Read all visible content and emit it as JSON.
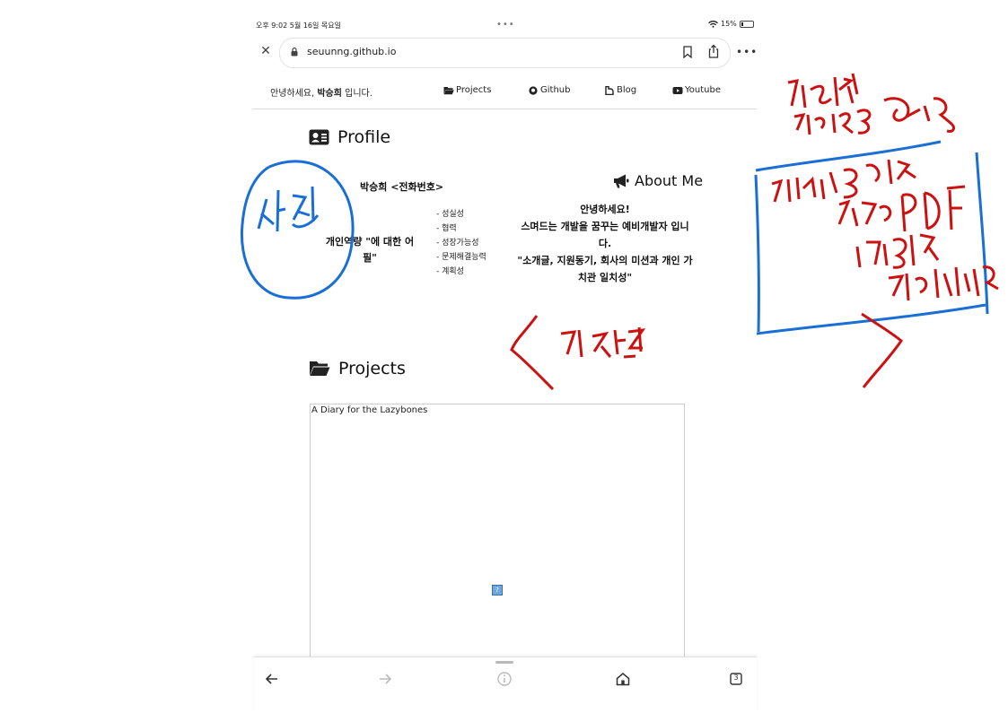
{
  "status_bar": {
    "time_date": "오후 9:02   5월 16일 목요일",
    "dots": "•••",
    "battery": "15%"
  },
  "browser": {
    "url": "seuunng.github.io",
    "icons": [
      "close-icon",
      "lock-icon",
      "bookmark-icon",
      "share-icon",
      "more-icon"
    ]
  },
  "site_nav": {
    "greeting_prefix": "안녕하세요, ",
    "greeting_name": "박승희",
    "greeting_suffix": " 입니다.",
    "links": [
      "Projects",
      "Github",
      "Blog",
      "Youtube"
    ]
  },
  "profile": {
    "heading": "Profile",
    "name_line": "박승희 <전화번호>",
    "competency": "개인역량 \"에 대한 어필\"",
    "traits": [
      "- 성실성",
      "- 협력",
      "- 성장가능성",
      "- 문제해결능력",
      "- 계획성"
    ]
  },
  "about": {
    "heading": "About Me",
    "lines": [
      "안녕하세요!",
      "스며드는 개발을 꿈꾸는 예비개발자 입니다.",
      "\"소개글, 지원동기, 회사의 미션과 개인 가치관 일치성\""
    ]
  },
  "projects": {
    "heading": "Projects",
    "card_title": "A Diary for the Lazybones",
    "image_placeholder": "?"
  },
  "toolbar": {
    "icons": [
      "back-icon",
      "forward-icon",
      "info-icon",
      "home-icon",
      "tabs-icon"
    ],
    "tab_count": "3"
  },
  "annotations": {
    "ink_color": "#cc1111",
    "highlight_color": "#1a6fd6",
    "photo_label": "사진",
    "top_note": "긴버전 리드미 연결",
    "box_note": "가나다라 언제 작성 PDF 이력서로 뽑으면 됨",
    "mid_note": "깃 잔디"
  }
}
